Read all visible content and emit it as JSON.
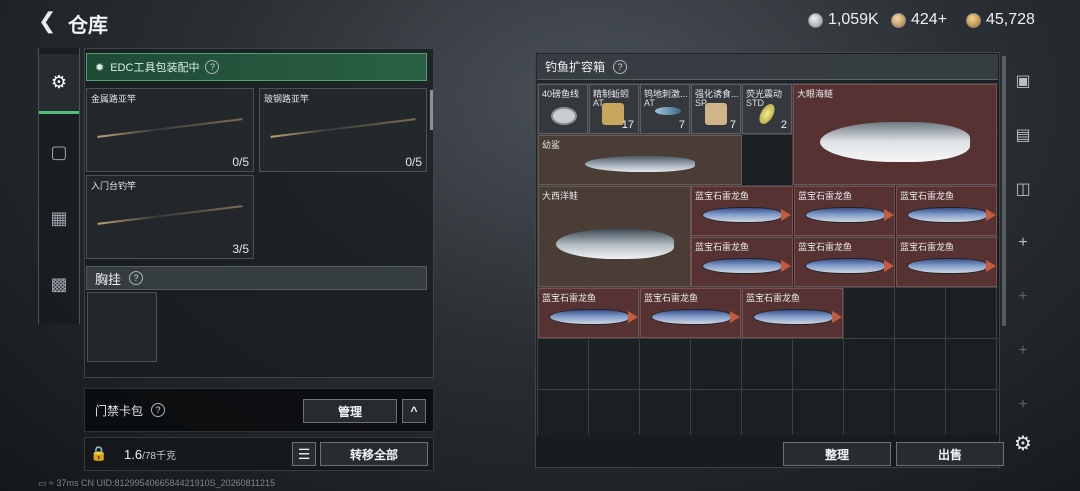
{
  "header": {
    "title": "仓库",
    "currencies": [
      {
        "icon": "silver-coin-icon",
        "value": "1,059K"
      },
      {
        "icon": "bronze-coin-icon",
        "value": "424+"
      },
      {
        "icon": "gold-coin-icon",
        "value": "45,728"
      }
    ]
  },
  "rail": {
    "tabs": [
      {
        "icon": "pistol-icon",
        "active": true
      },
      {
        "icon": "backpack-icon",
        "active": false
      },
      {
        "icon": "vest-icon",
        "active": false
      },
      {
        "icon": "toolbox-icon",
        "active": false
      }
    ]
  },
  "left": {
    "edc_title": "EDC工具包装配中",
    "slots": [
      {
        "label": "金属路亚竿",
        "count": "0/5"
      },
      {
        "label": "玻钢路亚竿",
        "count": "0/5"
      },
      {
        "label": "入门台钓竿",
        "count": "3/5"
      }
    ],
    "chest_title": "胸挂",
    "q": "?"
  },
  "keycard": {
    "label": "门禁卡包",
    "manage": "管理",
    "collapse_icon": "^"
  },
  "weight": {
    "current": "1.6",
    "limit": "/78千克",
    "transfer_all": "转移全部"
  },
  "container": {
    "title": "钓鱼扩容箱",
    "items": [
      {
        "name": "40磅鱼线",
        "sub": "",
        "count": ""
      },
      {
        "name": "精制蚯蚓",
        "sub": "AT",
        "count": "17"
      },
      {
        "name": "钨地刺激...",
        "sub": "AT",
        "count": "7"
      },
      {
        "name": "强化诱食...",
        "sub": "SP",
        "count": "7"
      },
      {
        "name": "荧光震动",
        "sub": "STD",
        "count": "2"
      },
      {
        "name": "大眼海鲢",
        "sub": "",
        "count": ""
      },
      {
        "name": "幼鲨",
        "sub": "",
        "count": ""
      },
      {
        "name": "大西洋鲑",
        "sub": "",
        "count": ""
      },
      {
        "name": "蓝宝石雷龙鱼",
        "sub": "",
        "count": ""
      }
    ],
    "sort": "整理",
    "sell": "出售"
  },
  "status": {
    "ping": "37ms",
    "uid": "CN UID:8129954066584421910S_20260811215"
  }
}
